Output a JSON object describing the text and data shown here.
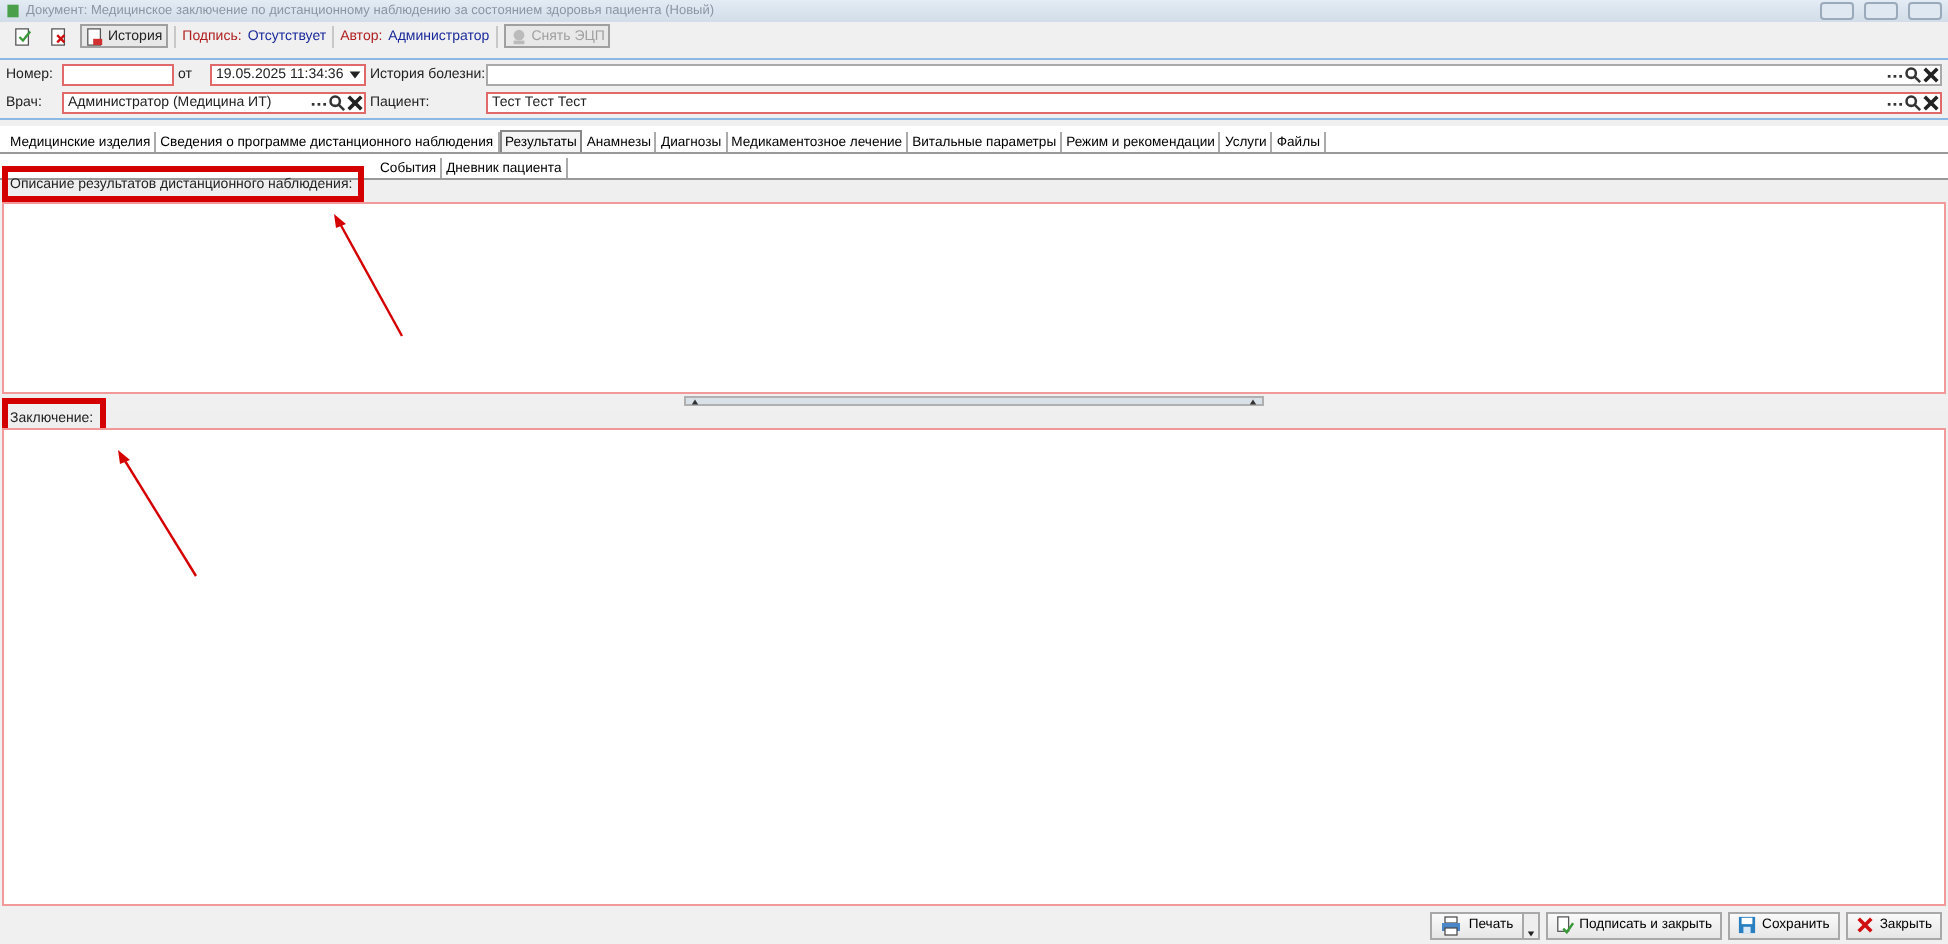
{
  "window": {
    "title": "Документ: Медицинское заключение по дистанционному наблюдению за состоянием здоровья пациента (Новый)"
  },
  "toolbar": {
    "history_button": "История",
    "signature_label": "Подпись:",
    "signature_value": "Отсутствует",
    "author_label": "Автор:",
    "author_value": "Администратор",
    "remove_signature_button": {
      "label": "Снять ЭЦП",
      "disabled": true
    }
  },
  "form": {
    "number_label": "Номер:",
    "date_label": "от",
    "date_value": "19.05.2025 11:34:36",
    "history_label": "История болезни:",
    "doctor_label": "Врач:",
    "doctor_value": "Администратор (Медицина ИТ)",
    "patient_label": "Пациент:",
    "patient_value": "Тест Тест Тест"
  },
  "tabs": [
    {
      "label": "Медицинские изделия",
      "selected": false
    },
    {
      "label": "Сведения о программе дистанционного наблюдения",
      "selected": false
    },
    {
      "label": "Результаты",
      "selected": true
    },
    {
      "label": "Анамнезы",
      "selected": false
    },
    {
      "label": "Диагнозы",
      "selected": false
    },
    {
      "label": "Медикаментозное лечение",
      "selected": false
    },
    {
      "label": "Витальные параметры",
      "selected": false
    },
    {
      "label": "Режим и рекомендации",
      "selected": false
    },
    {
      "label": "Услуги",
      "selected": false
    },
    {
      "label": "Файлы",
      "selected": false
    }
  ],
  "subtabs": [
    {
      "label": "События",
      "selected": false
    },
    {
      "label": "Дневник пациента",
      "selected": false
    }
  ],
  "sections": [
    {
      "label": "Описание результатов дистанционного наблюдения:",
      "highlighted": true
    },
    {
      "label": "Заключение:",
      "highlighted": true
    }
  ],
  "footer": {
    "buttons": [
      {
        "kind": "print",
        "label": "Печать"
      },
      {
        "kind": "sign",
        "label": "Подписать и закрыть"
      },
      {
        "kind": "save",
        "label": "Сохранить"
      },
      {
        "kind": "close",
        "label": "Закрыть"
      }
    ]
  }
}
